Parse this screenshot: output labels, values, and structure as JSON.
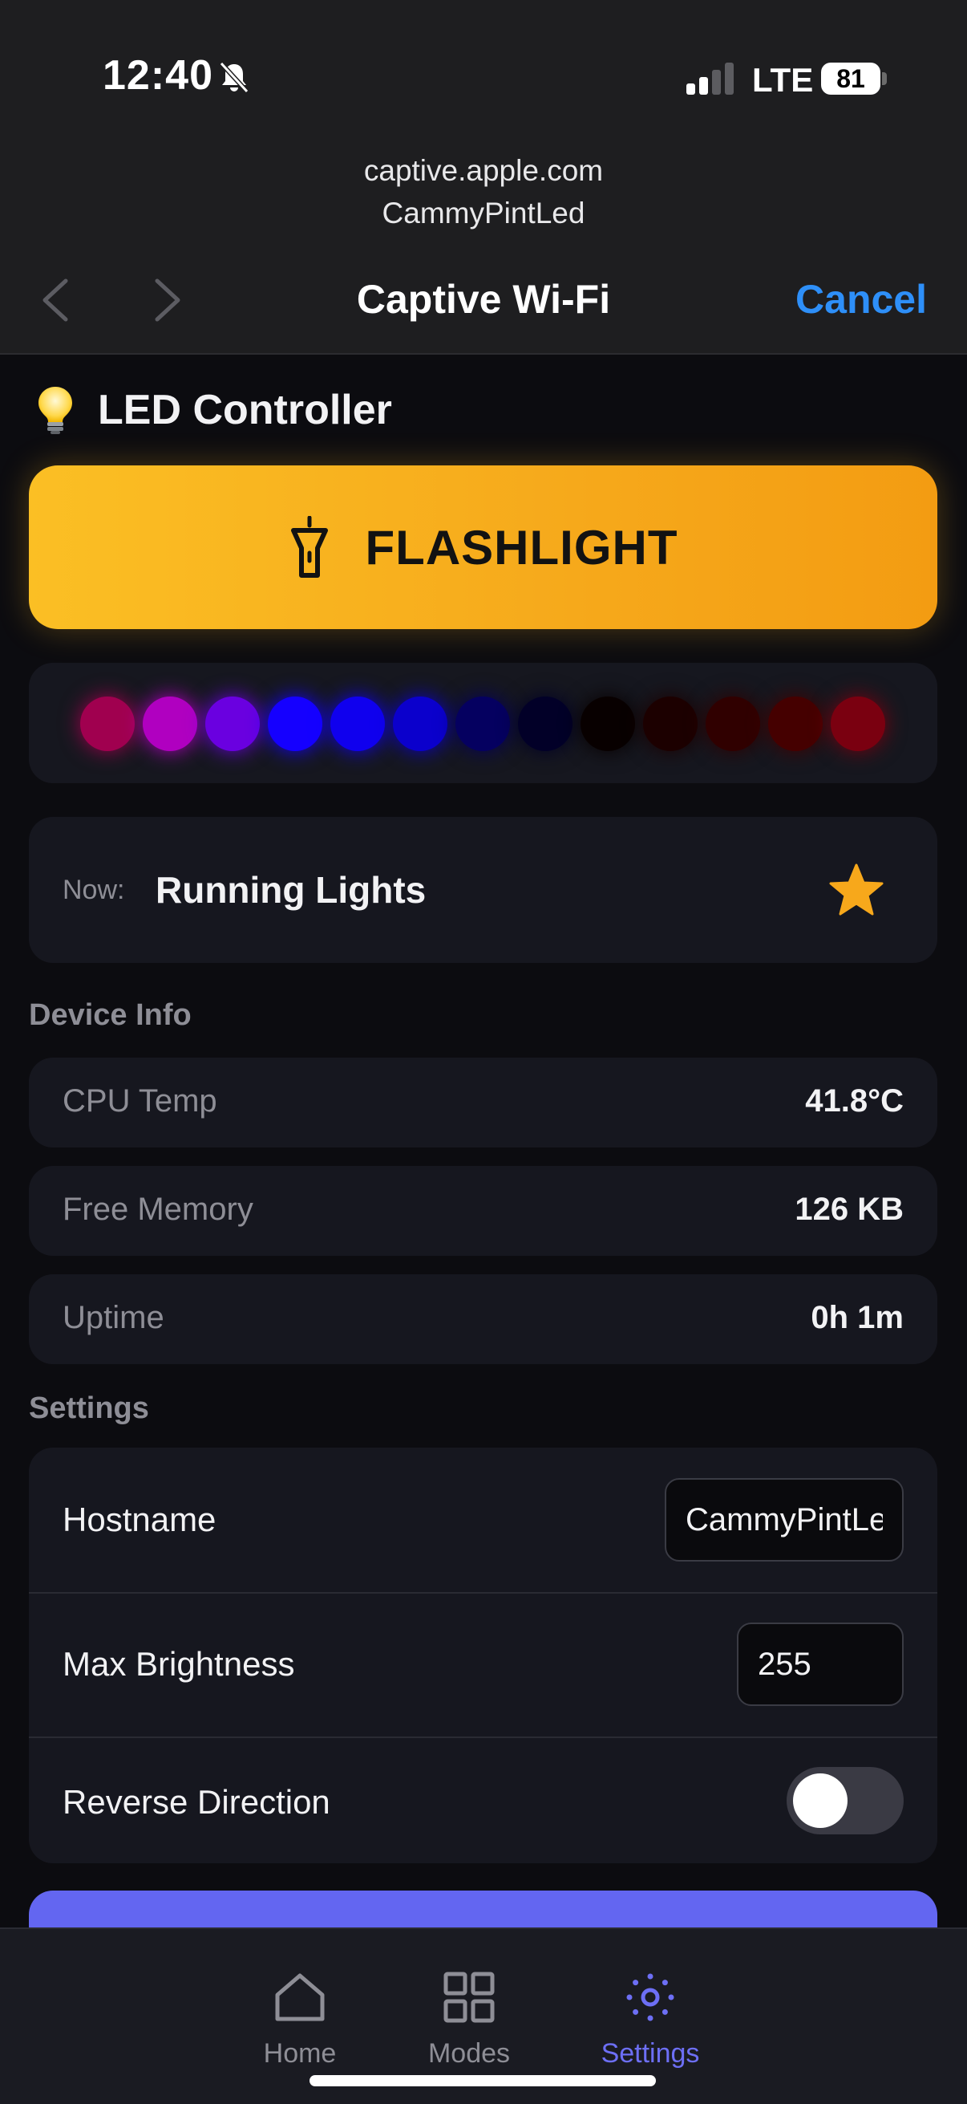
{
  "status_bar": {
    "time": "12:40",
    "carrier": "LTE",
    "battery": "81"
  },
  "browser": {
    "host": "captive.apple.com",
    "ssid": "CammyPintLed",
    "title": "Captive Wi-Fi",
    "cancel_label": "Cancel"
  },
  "app": {
    "title": "LED Controller",
    "flashlight_label": "FLASHLIGHT",
    "accent_color": "#fbbf24"
  },
  "led_preview": {
    "colors": [
      "#a0004f",
      "#b000c0",
      "#6a00e0",
      "#1500ff",
      "#1000ee",
      "#0b00cc",
      "#050060",
      "#020028",
      "#080000",
      "#1c0000",
      "#300000",
      "#450000",
      "#7a0010"
    ]
  },
  "now_playing": {
    "label": "Now:",
    "mode": "Running Lights"
  },
  "device_info": {
    "heading": "Device Info",
    "items": [
      {
        "label": "CPU Temp",
        "value": "41.8°C"
      },
      {
        "label": "Free Memory",
        "value": "126 KB"
      },
      {
        "label": "Uptime",
        "value": "0h 1m"
      }
    ]
  },
  "settings": {
    "heading": "Settings",
    "hostname_label": "Hostname",
    "hostname_value": "CammyPintLed",
    "brightness_label": "Max Brightness",
    "brightness_value": "255",
    "reverse_label": "Reverse Direction",
    "reverse_enabled": false
  },
  "tabs": [
    {
      "label": "Home",
      "icon": "home-icon",
      "active": false
    },
    {
      "label": "Modes",
      "icon": "grid-icon",
      "active": false
    },
    {
      "label": "Settings",
      "icon": "settings-icon",
      "active": true
    }
  ]
}
